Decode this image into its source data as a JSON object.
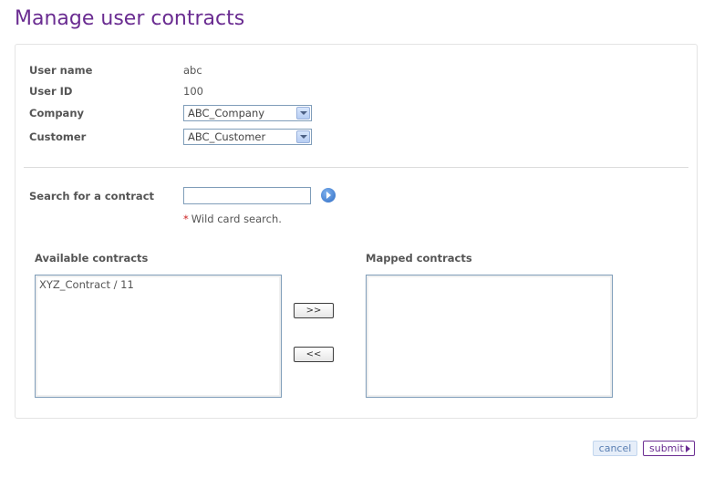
{
  "page": {
    "title": "Manage user contracts"
  },
  "user": {
    "name_label": "User name",
    "name_value": "abc",
    "id_label": "User ID",
    "id_value": "100",
    "company_label": "Company",
    "company_value": "ABC_Company",
    "customer_label": "Customer",
    "customer_value": "ABC_Customer"
  },
  "search": {
    "label": "Search for a contract",
    "value": "",
    "hint_asterisk": "*",
    "hint": "Wild card search.",
    "go_icon": "go-arrow-icon"
  },
  "contracts": {
    "available_label": "Available contracts",
    "available_items": [
      "XYZ_Contract / 11"
    ],
    "mapped_label": "Mapped contracts",
    "mapped_items": [],
    "add_label": ">>",
    "remove_label": "<<"
  },
  "actions": {
    "cancel_label": "cancel",
    "submit_label": "submit"
  },
  "colors": {
    "brand": "#6a2c91",
    "required": "#cc2222",
    "cancel_bg": "#e6eef9"
  }
}
